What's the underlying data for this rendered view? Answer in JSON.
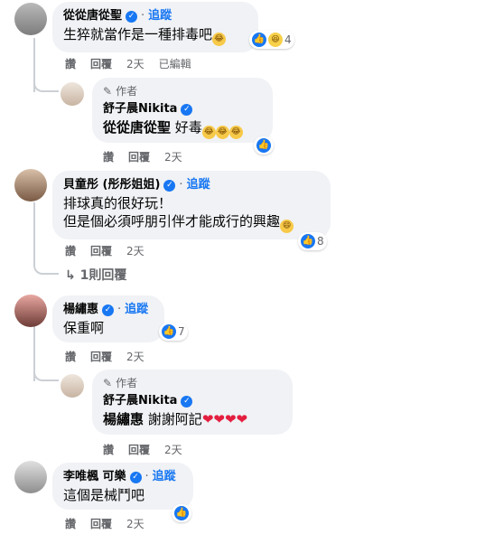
{
  "comments": [
    {
      "name": "從從唐從聖",
      "follow": "追蹤",
      "text": "生猝就當作是一種排毒吧",
      "reaction_count": "4",
      "actions": {
        "like": "讚",
        "reply": "回覆",
        "time": "2天",
        "edited": "已編輯"
      }
    },
    {
      "author_badge": "作者",
      "name": "舒子晨Nikita",
      "mention": "從從唐從聖",
      "text": "好毒",
      "actions": {
        "like": "讚",
        "reply": "回覆",
        "time": "2天"
      }
    },
    {
      "name": "貝童彤 (彤彤姐姐)",
      "follow": "追蹤",
      "text_line1": "排球真的很好玩！",
      "text_line2": "但是個必須呼朋引伴才能成行的興趣",
      "reaction_count": "8",
      "actions": {
        "like": "讚",
        "reply": "回覆",
        "time": "2天"
      },
      "replies_link": "1則回覆"
    },
    {
      "name": "楊繡惠",
      "follow": "追蹤",
      "text": "保重啊",
      "reaction_count": "7",
      "actions": {
        "like": "讚",
        "reply": "回覆",
        "time": "2天"
      }
    },
    {
      "author_badge": "作者",
      "name": "舒子晨Nikita",
      "mention": "楊繡惠",
      "text": "謝謝阿記",
      "actions": {
        "like": "讚",
        "reply": "回覆",
        "time": "2天"
      }
    },
    {
      "name": "李唯楓 可樂",
      "follow": "追蹤",
      "text": "這個是械鬥吧",
      "actions": {
        "like": "讚",
        "reply": "回覆",
        "time": "2天"
      }
    }
  ],
  "colors": {
    "accent": "#1877f2",
    "bubble": "#f0f2f5",
    "meta": "#65676b",
    "heart": "#e41e3f"
  }
}
